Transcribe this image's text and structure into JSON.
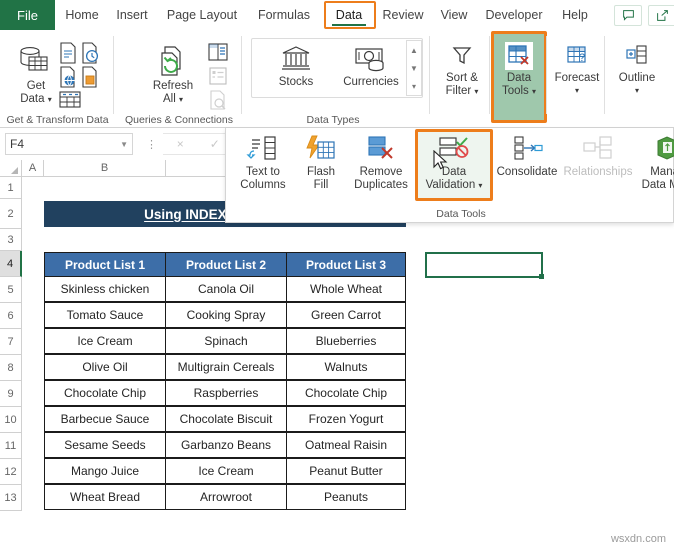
{
  "app": {
    "title": "Microsoft Excel",
    "watermark": "wsxdn.com"
  },
  "ribbon": {
    "tabs": [
      {
        "id": "file",
        "label": "File",
        "active": false
      },
      {
        "id": "home",
        "label": "Home",
        "active": false
      },
      {
        "id": "insert",
        "label": "Insert",
        "active": false
      },
      {
        "id": "page-layout",
        "label": "Page Layout",
        "active": false
      },
      {
        "id": "formulas",
        "label": "Formulas",
        "active": false
      },
      {
        "id": "data",
        "label": "Data",
        "active": true
      },
      {
        "id": "review",
        "label": "Review",
        "active": false
      },
      {
        "id": "view",
        "label": "View",
        "active": false
      },
      {
        "id": "developer",
        "label": "Developer",
        "active": false
      },
      {
        "id": "help",
        "label": "Help",
        "active": false
      }
    ],
    "top_right_icons": [
      {
        "name": "comments-icon",
        "label": "Comments"
      },
      {
        "name": "share-icon",
        "label": "Share"
      }
    ],
    "groups": [
      {
        "id": "get-transform",
        "label": "Get & Transform Data",
        "buttons": [
          {
            "label": "Get\nData",
            "name": "get-data-button"
          }
        ]
      },
      {
        "id": "queries-connections",
        "label": "Queries & Connections",
        "buttons": [
          {
            "label": "Refresh\nAll",
            "name": "refresh-all-button"
          }
        ]
      },
      {
        "id": "data-types",
        "label": "Data Types",
        "buttons": [
          {
            "label": "Stocks",
            "name": "stocks-button"
          },
          {
            "label": "Currencies",
            "name": "currencies-button"
          }
        ]
      },
      {
        "id": "sort-filter",
        "label": "",
        "buttons": [
          {
            "label": "Sort &\nFilter",
            "name": "sort-filter-button"
          }
        ]
      },
      {
        "id": "data-tools-grp",
        "label": "",
        "buttons": [
          {
            "label": "Data\nTools",
            "name": "data-tools-button",
            "highlighted": true
          }
        ]
      },
      {
        "id": "forecast",
        "label": "",
        "buttons": [
          {
            "label": "Forecast",
            "name": "forecast-button"
          }
        ]
      },
      {
        "id": "outline",
        "label": "",
        "buttons": [
          {
            "label": "Outline",
            "name": "outline-button"
          }
        ]
      }
    ],
    "labels": {
      "get_data_line1": "Get",
      "get_data_line2": "Data",
      "refresh_line1": "Refresh",
      "refresh_line2": "All",
      "stocks": "Stocks",
      "currencies": "Currencies",
      "sort_line1": "Sort &",
      "sort_line2": "Filter",
      "datatools_line1": "Data",
      "datatools_line2": "Tools",
      "forecast": "Forecast",
      "outline": "Outline",
      "grp_get_transform": "Get & Transform Data",
      "grp_queries": "Queries & Connections",
      "grp_data_types": "Data Types"
    }
  },
  "data_tools_panel": {
    "group_label": "Data Tools",
    "items": [
      {
        "name": "text-to-columns-button",
        "line1": "Text to",
        "line2": "Columns",
        "enabled": true
      },
      {
        "name": "flash-fill-button",
        "line1": "Flash",
        "line2": "Fill",
        "enabled": true
      },
      {
        "name": "remove-duplicates-button",
        "line1": "Remove",
        "line2": "Duplicates",
        "enabled": true
      },
      {
        "name": "data-validation-button",
        "line1": "Data",
        "line2": "Validation",
        "enabled": true,
        "highlighted": true,
        "has_dropdown": true
      },
      {
        "name": "consolidate-button",
        "line1": "Consolidate",
        "line2": "",
        "enabled": true
      },
      {
        "name": "relationships-button",
        "line1": "Relationships",
        "line2": "",
        "enabled": false
      },
      {
        "name": "manage-data-model-button",
        "line1": "Manage",
        "line2": "Data Model",
        "enabled": true
      }
    ]
  },
  "formula_bar": {
    "name_box_value": "F4",
    "formula_value": "",
    "cancel_glyph": "×",
    "enter_glyph": "✓"
  },
  "sheet": {
    "column_headers": [
      "A",
      "B"
    ],
    "row_headers": [
      "1",
      "2",
      "3",
      "4",
      "5",
      "6",
      "7",
      "8",
      "9",
      "10",
      "11",
      "12",
      "13"
    ],
    "selected_row": "4",
    "selected_cell": "F4",
    "selected_cell_value": "",
    "title_banner": "Using INDEX and MATCH",
    "table": {
      "headers": [
        "Product List 1",
        "Product List 2",
        "Product List 3"
      ],
      "rows": [
        [
          "Skinless chicken",
          "Canola Oil",
          "Whole Wheat"
        ],
        [
          "Tomato Sauce",
          "Cooking Spray",
          "Green Carrot"
        ],
        [
          "Ice Cream",
          "Spinach",
          "Blueberries"
        ],
        [
          "Olive Oil",
          "Multigrain Cereals",
          "Walnuts"
        ],
        [
          "Chocolate Chip",
          "Raspberries",
          "Chocolate Chip"
        ],
        [
          "Barbecue Sauce",
          "Chocolate Biscuit",
          "Frozen Yogurt"
        ],
        [
          "Sesame Seeds",
          "Garbanzo Beans",
          "Oatmeal Raisin"
        ],
        [
          "Mango Juice",
          "Ice Cream",
          "Peanut Butter"
        ],
        [
          "Wheat Bread",
          "Arrowroot",
          "Peanuts"
        ]
      ]
    }
  },
  "colors": {
    "excel_green": "#217346",
    "highlight_orange": "#ed7d1b",
    "highlight_green_fill": "#9fc8ac",
    "title_navy": "#21415f",
    "header_blue": "#3d6ea8",
    "selection_green": "#21704a"
  }
}
